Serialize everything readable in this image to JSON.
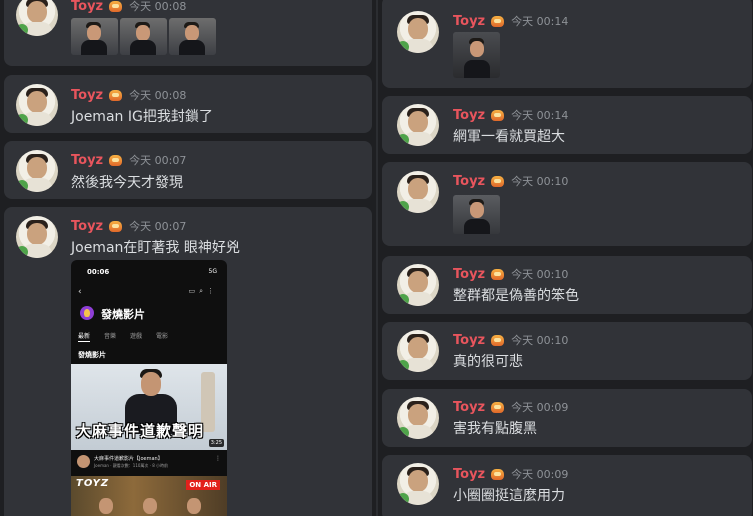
{
  "user": {
    "name": "Toyz",
    "badge_icon": "flame-badge-icon",
    "name_color": "#e8555d"
  },
  "left_messages": [
    {
      "time": "今天 00:08",
      "type": "images",
      "image_count": 3
    },
    {
      "time": "今天 00:08",
      "text": "Joeman IG把我封鎖了"
    },
    {
      "time": "今天 00:07",
      "text": "然後我今天才發現"
    },
    {
      "time": "今天 00:07",
      "text": "Joeman在盯著我 眼神好兇",
      "type": "text+image"
    }
  ],
  "right_messages": [
    {
      "time": "今天 00:14",
      "type": "image"
    },
    {
      "time": "今天 00:14",
      "text": "網軍一看就買超大"
    },
    {
      "time": "今天 00:10",
      "type": "image"
    },
    {
      "time": "今天 00:10",
      "text": "整群都是偽善的笨色"
    },
    {
      "time": "今天 00:10",
      "text": "真的很可悲"
    },
    {
      "time": "今天 00:09",
      "text": "害我有點腹黑"
    },
    {
      "time": "今天 00:09",
      "text": "小圈圈挺這麼用力"
    }
  ],
  "phone": {
    "status_time": "00:06",
    "signal": "5G",
    "channel_title": "發燒影片",
    "tabs": [
      "最新",
      "音樂",
      "遊戲",
      "電影"
    ],
    "section": "發燒影片",
    "video_caption": "大麻事件道歉聲明",
    "video_duration": "3:25",
    "video_title": "大麻事件道歉影片【Joeman】",
    "video_sub": "Joeman · 觀看次數：110萬次 · 8 小時前",
    "video2_logo": "TOYZ",
    "video2_badge": "ON AIR"
  }
}
